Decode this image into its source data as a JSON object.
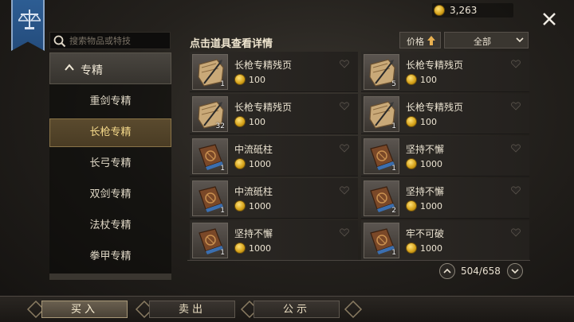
{
  "currency": {
    "amount": "3,263"
  },
  "search": {
    "placeholder": "搜索物品或特技"
  },
  "categories": {
    "header": "专精",
    "items": [
      {
        "label": "重剑专精",
        "active": false
      },
      {
        "label": "长枪专精",
        "active": true
      },
      {
        "label": "长弓专精",
        "active": false
      },
      {
        "label": "双剑专精",
        "active": false
      },
      {
        "label": "法杖专精",
        "active": false
      },
      {
        "label": "拳甲专精",
        "active": false
      }
    ]
  },
  "header": {
    "hint": "点击道具查看详情",
    "sort_label": "价格",
    "filter_label": "全部"
  },
  "listings": [
    {
      "name": "长枪专精残页",
      "price": "100",
      "qty": "1",
      "icon": "scroll-page-icon"
    },
    {
      "name": "长枪专精残页",
      "price": "100",
      "qty": "5",
      "icon": "scroll-page-icon"
    },
    {
      "name": "长枪专精残页",
      "price": "100",
      "qty": "32",
      "icon": "scroll-page-icon"
    },
    {
      "name": "长枪专精残页",
      "price": "100",
      "qty": "1",
      "icon": "scroll-page-icon"
    },
    {
      "name": "中流砥柱",
      "price": "1000",
      "qty": "1",
      "icon": "skill-book-icon"
    },
    {
      "name": "坚持不懈",
      "price": "1000",
      "qty": "1",
      "icon": "skill-book-icon"
    },
    {
      "name": "中流砥柱",
      "price": "1000",
      "qty": "1",
      "icon": "skill-book-icon"
    },
    {
      "name": "坚持不懈",
      "price": "1000",
      "qty": "2",
      "icon": "skill-book-icon"
    },
    {
      "name": "坚持不懈",
      "price": "1000",
      "qty": "1",
      "icon": "skill-book-icon"
    },
    {
      "name": "牢不可破",
      "price": "1000",
      "qty": "1",
      "icon": "skill-book-icon"
    }
  ],
  "pager": {
    "text": "504/658"
  },
  "tabs": [
    {
      "label": "买入",
      "active": true
    },
    {
      "label": "卖出",
      "active": false
    },
    {
      "label": "公示",
      "active": false
    }
  ],
  "colors": {
    "accent_gold": "#f5d98a",
    "banner_blue": "#2d5d93",
    "coin_gold": "#d4a017"
  }
}
